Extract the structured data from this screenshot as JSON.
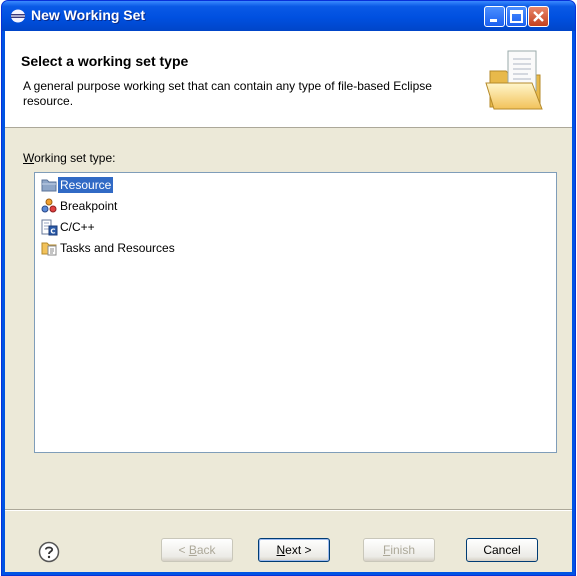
{
  "window": {
    "title": "New Working Set",
    "controls": {
      "minimize": "minimize-icon",
      "maximize": "maximize-icon",
      "close": "close-icon"
    }
  },
  "header": {
    "title": "Select a working set type",
    "description": "A general purpose working set that can contain any type of file-based Eclipse resource."
  },
  "list": {
    "label_underlined": "W",
    "label_rest": "orking set type:",
    "items": [
      {
        "label": "Resource",
        "icon": "folder-resource-icon",
        "selected": true
      },
      {
        "label": "Breakpoint",
        "icon": "breakpoint-icon",
        "selected": false
      },
      {
        "label": "C/C++",
        "icon": "cpp-project-icon",
        "selected": false
      },
      {
        "label": "Tasks and Resources",
        "icon": "tasks-folder-icon",
        "selected": false
      }
    ]
  },
  "buttons": {
    "back_prefix": "< ",
    "back_mnemonic": "B",
    "back_rest": "ack",
    "next_mnemonic": "N",
    "next_rest": "ext >",
    "finish_mnemonic": "F",
    "finish_rest": "inish",
    "cancel": "Cancel"
  },
  "colors": {
    "titlebar": "#0054e3",
    "selection": "#316ac5",
    "dialog": "#ece9d8"
  }
}
